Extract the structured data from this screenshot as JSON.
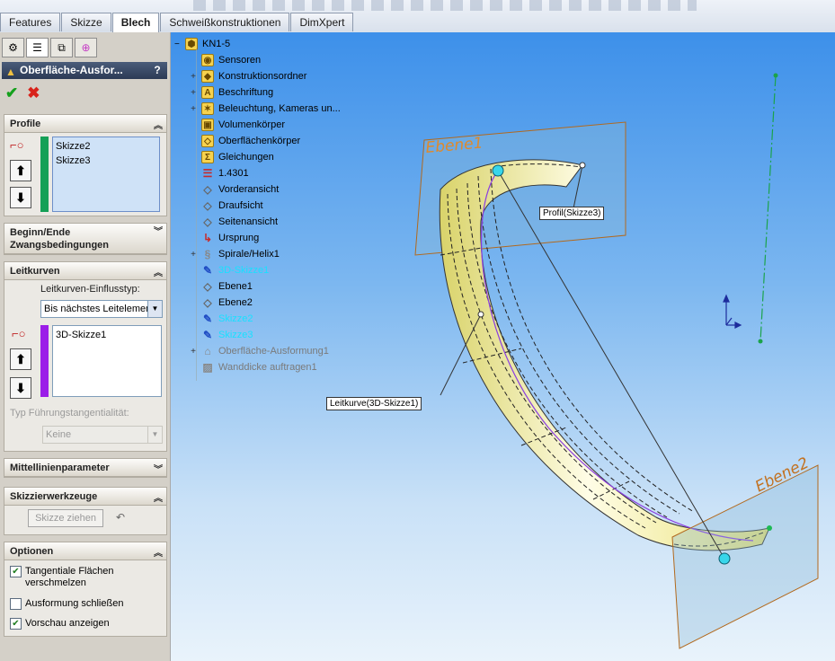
{
  "tabs": [
    {
      "label": "Features",
      "active": false
    },
    {
      "label": "Skizze",
      "active": false
    },
    {
      "label": "Blech",
      "active": true
    },
    {
      "label": "Schweißkonstruktionen",
      "active": false
    },
    {
      "label": "DimXpert",
      "active": false
    }
  ],
  "property_manager": {
    "title": "Oberfläche-Ausfor...",
    "help": "?",
    "profile": {
      "header": "Profile",
      "items": [
        "Skizze2",
        "Skizze3"
      ],
      "bar_color": "#15a057"
    },
    "constraints": {
      "header_line1": "Beginn/Ende",
      "header_line2": "Zwangsbedingungen"
    },
    "guides": {
      "header": "Leitkurven",
      "influence_label": "Leitkurven-Einflusstyp:",
      "influence_value": "Bis nächstes Leitelement",
      "items": [
        "3D-Skizze1"
      ],
      "bar_color": "#9b1ee8",
      "tangency_label": "Typ Führungstangentialität:",
      "tangency_value": "Keine"
    },
    "centerline": {
      "header": "Mittellinienparameter"
    },
    "sketch_tools": {
      "header": "Skizzierwerkzeuge",
      "button": "Skizze ziehen"
    },
    "options": {
      "header": "Optionen",
      "items": [
        {
          "label1": "Tangentiale Flächen",
          "label2": "verschmelzen",
          "checked": true
        },
        {
          "label1": "Ausformung schließen",
          "label2": "",
          "checked": false
        },
        {
          "label1": "Vorschau anzeigen",
          "label2": "",
          "checked": true
        }
      ]
    }
  },
  "tree": {
    "root": "KN1-5",
    "items": [
      {
        "label": "Sensoren",
        "icon": "sensor-icon",
        "expand": false,
        "style": "normal"
      },
      {
        "label": "Konstruktionsordner",
        "icon": "folder-icon",
        "expand": true,
        "style": "normal"
      },
      {
        "label": "Beschriftung",
        "icon": "annotation-icon",
        "expand": true,
        "style": "normal"
      },
      {
        "label": "Beleuchtung, Kameras un...",
        "icon": "light-icon",
        "expand": true,
        "style": "normal"
      },
      {
        "label": "Volumenkörper",
        "icon": "solid-body-icon",
        "expand": false,
        "style": "normal"
      },
      {
        "label": "Oberflächenkörper",
        "icon": "surface-body-icon",
        "expand": false,
        "style": "normal"
      },
      {
        "label": "Gleichungen",
        "icon": "equation-icon",
        "expand": false,
        "style": "normal"
      },
      {
        "label": "1.4301",
        "icon": "material-icon",
        "expand": false,
        "style": "normal"
      },
      {
        "label": "Vorderansicht",
        "icon": "plane-icon",
        "expand": false,
        "style": "normal"
      },
      {
        "label": "Draufsicht",
        "icon": "plane-icon",
        "expand": false,
        "style": "normal"
      },
      {
        "label": "Seitenansicht",
        "icon": "plane-icon",
        "expand": false,
        "style": "normal"
      },
      {
        "label": "Ursprung",
        "icon": "origin-icon",
        "expand": false,
        "style": "normal"
      },
      {
        "label": "Spirale/Helix1",
        "icon": "helix-icon",
        "expand": true,
        "style": "normal"
      },
      {
        "label": "3D-Skizze1",
        "icon": "3d-sketch-icon",
        "expand": false,
        "style": "cyan"
      },
      {
        "label": "Ebene1",
        "icon": "plane-icon",
        "expand": false,
        "style": "normal"
      },
      {
        "label": "Ebene2",
        "icon": "plane-icon",
        "expand": false,
        "style": "normal"
      },
      {
        "label": "Skizze2",
        "icon": "sketch-icon",
        "expand": false,
        "style": "cyan"
      },
      {
        "label": "Skizze3",
        "icon": "sketch-icon",
        "expand": false,
        "style": "cyan"
      },
      {
        "label": "Oberfläche-Ausformung1",
        "icon": "loft-icon",
        "expand": true,
        "style": "grey"
      },
      {
        "label": "Wanddicke auftragen1",
        "icon": "thicken-icon",
        "expand": false,
        "style": "grey"
      }
    ]
  },
  "viewport": {
    "plane1_label": "Ebene1",
    "plane2_label": "Ebene2",
    "callout_profile": "Profil(Skizze3)",
    "callout_guide": "Leitkurve(3D-Skizze1)"
  }
}
